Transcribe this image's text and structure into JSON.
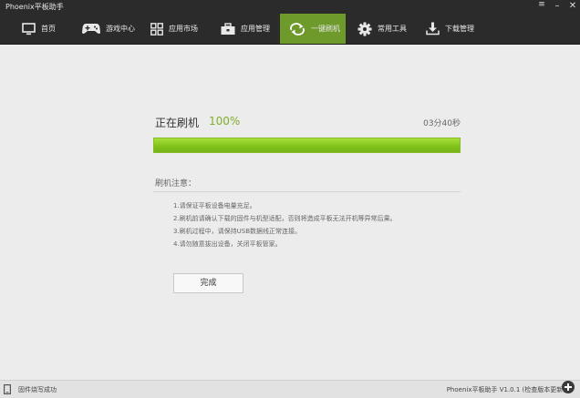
{
  "window": {
    "title": "Phoenix平板助手",
    "menu_glyph": "≡",
    "minimize_glyph": "–",
    "close_glyph": "✕"
  },
  "nav": {
    "active_index": 4,
    "active_color": "#6e9a2c",
    "items": [
      {
        "label": "首页",
        "icon": "monitor-icon"
      },
      {
        "label": "游戏中心",
        "icon": "gamepad-icon"
      },
      {
        "label": "应用市场",
        "icon": "grid-icon"
      },
      {
        "label": "应用管理",
        "icon": "toolbox-icon"
      },
      {
        "label": "一键刷机",
        "icon": "refresh-icon"
      },
      {
        "label": "常用工具",
        "icon": "gear-icon"
      },
      {
        "label": "下载管理",
        "icon": "download-icon"
      }
    ]
  },
  "flash": {
    "title": "正在刷机",
    "percent_text": "100%",
    "progress": 1.0,
    "elapsed": "03分40秒",
    "progress_color": "#82c31c"
  },
  "notes": {
    "heading": "刷机注意：",
    "items": [
      "1.请保证平板设备电量充足。",
      "2.刷机前请确认下载的固件与机型适配，否则将造成平板无法开机等异常后果。",
      "3.刷机过程中，请保持USB数据线正常连接。",
      "4.请勿随意拔出设备，关闭平板管家。"
    ]
  },
  "actions": {
    "finish_label": "完成"
  },
  "status": {
    "message": "固件烧写成功",
    "version": "Phoenix平板助手 V1.0.1 (检查版本更新)"
  }
}
